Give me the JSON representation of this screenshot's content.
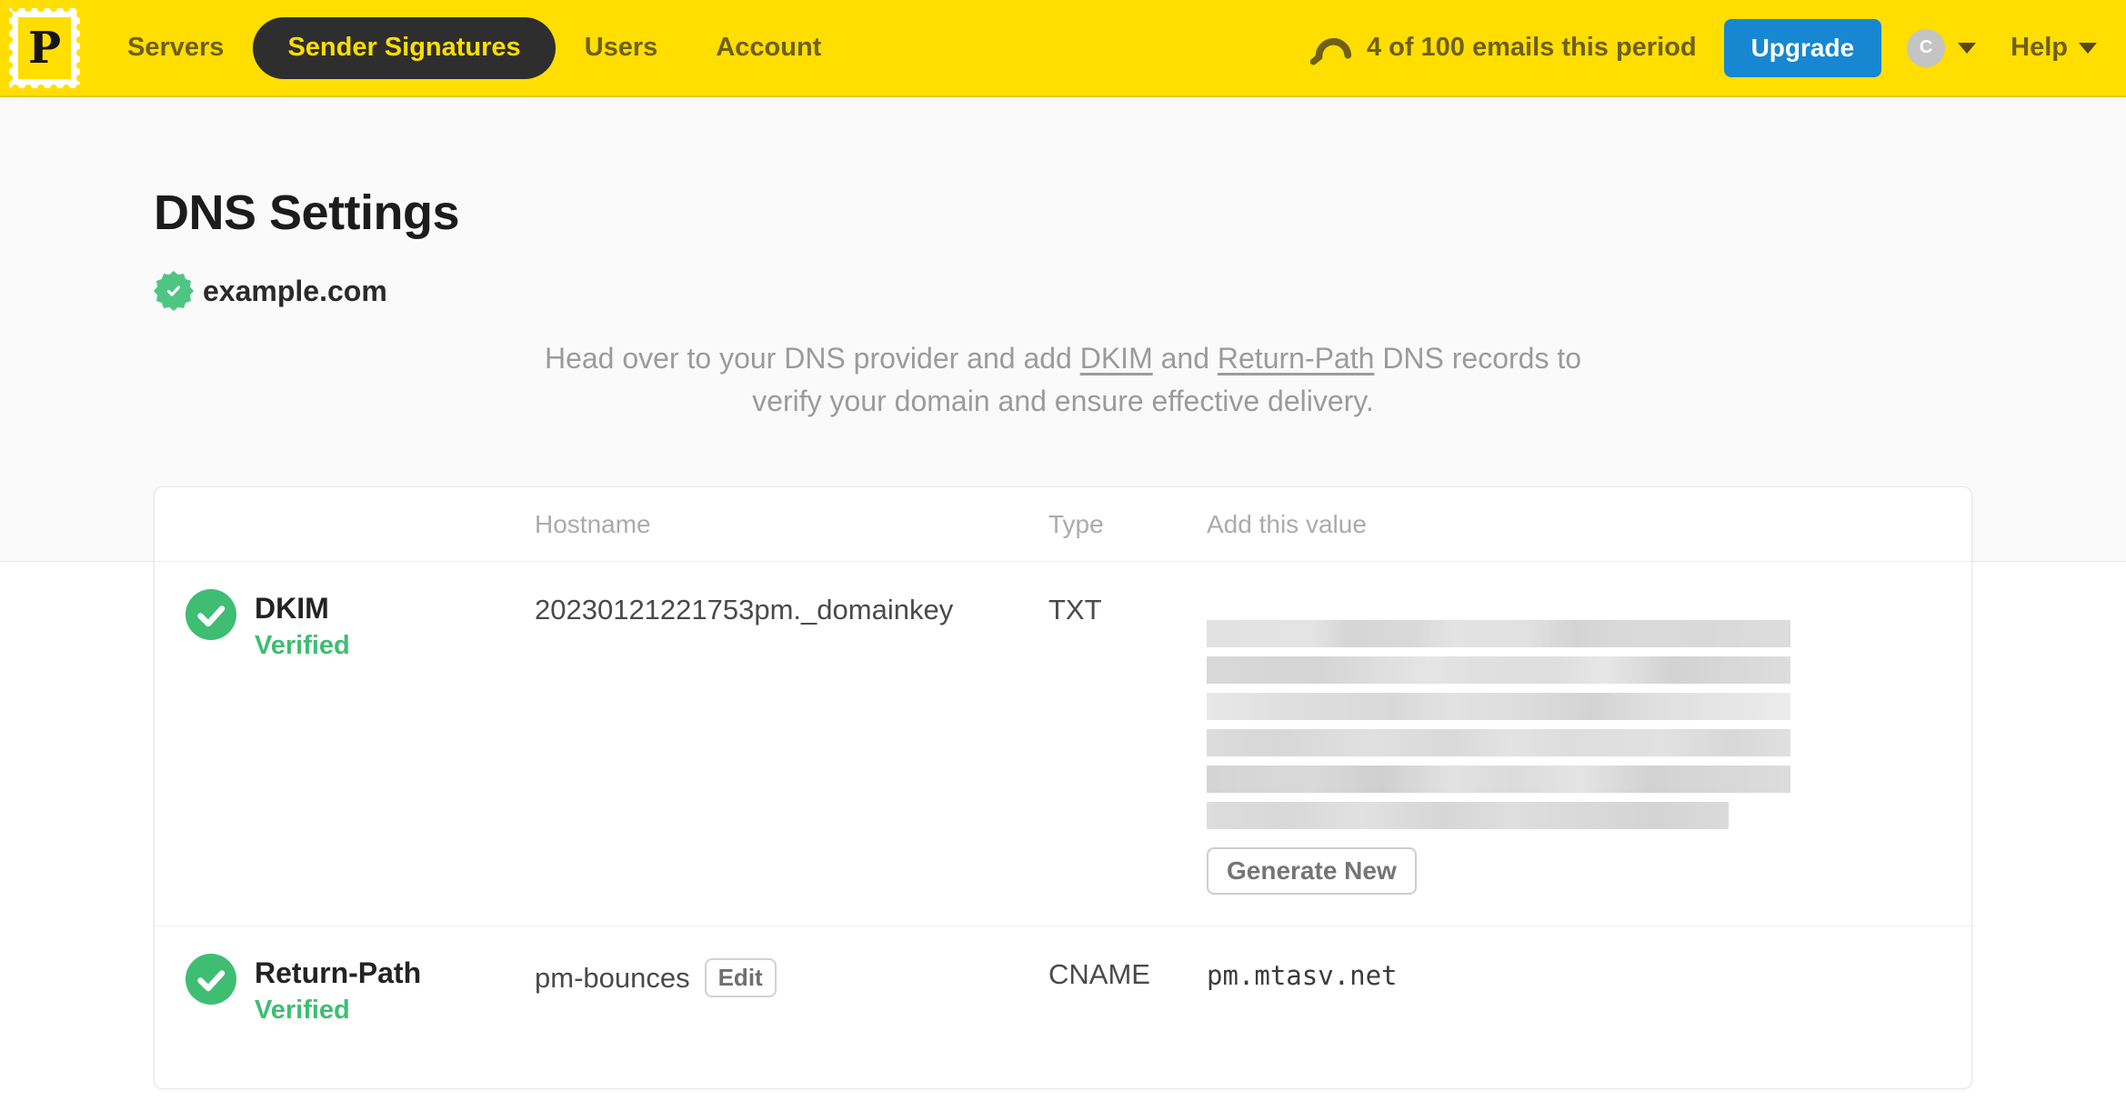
{
  "colors": {
    "brand_yellow": "#FFDE00",
    "nav_pill_bg": "#2E2E2E",
    "upgrade_blue": "#1787D1",
    "verified_green": "#3EBD73",
    "badge_green": "#4EC681"
  },
  "navbar": {
    "logo_letter": "P",
    "items": [
      {
        "label": "Servers",
        "active": false
      },
      {
        "label": "Sender Signatures",
        "active": true
      },
      {
        "label": "Users",
        "active": false
      },
      {
        "label": "Account",
        "active": false
      }
    ],
    "usage_text": "4 of 100 emails this period",
    "upgrade_label": "Upgrade",
    "avatar_initial": "C",
    "help_label": "Help"
  },
  "page": {
    "title": "DNS Settings",
    "domain": "example.com",
    "description": {
      "part1": "Head over to your DNS provider and add ",
      "link_dkim": "DKIM",
      "part2": " and ",
      "link_return_path": "Return-Path",
      "part3": " DNS records to verify your domain and ensure effective delivery."
    }
  },
  "dns_table": {
    "headers": {
      "hostname": "Hostname",
      "type": "Type",
      "value": "Add this value"
    },
    "rows": [
      {
        "name": "DKIM",
        "status": "Verified",
        "hostname": "20230121221753pm._domainkey",
        "type": "TXT",
        "value_redacted": true,
        "action_label": "Generate New"
      },
      {
        "name": "Return-Path",
        "status": "Verified",
        "hostname": "pm-bounces",
        "edit_label": "Edit",
        "type": "CNAME",
        "value": "pm.mtasv.net"
      }
    ]
  }
}
